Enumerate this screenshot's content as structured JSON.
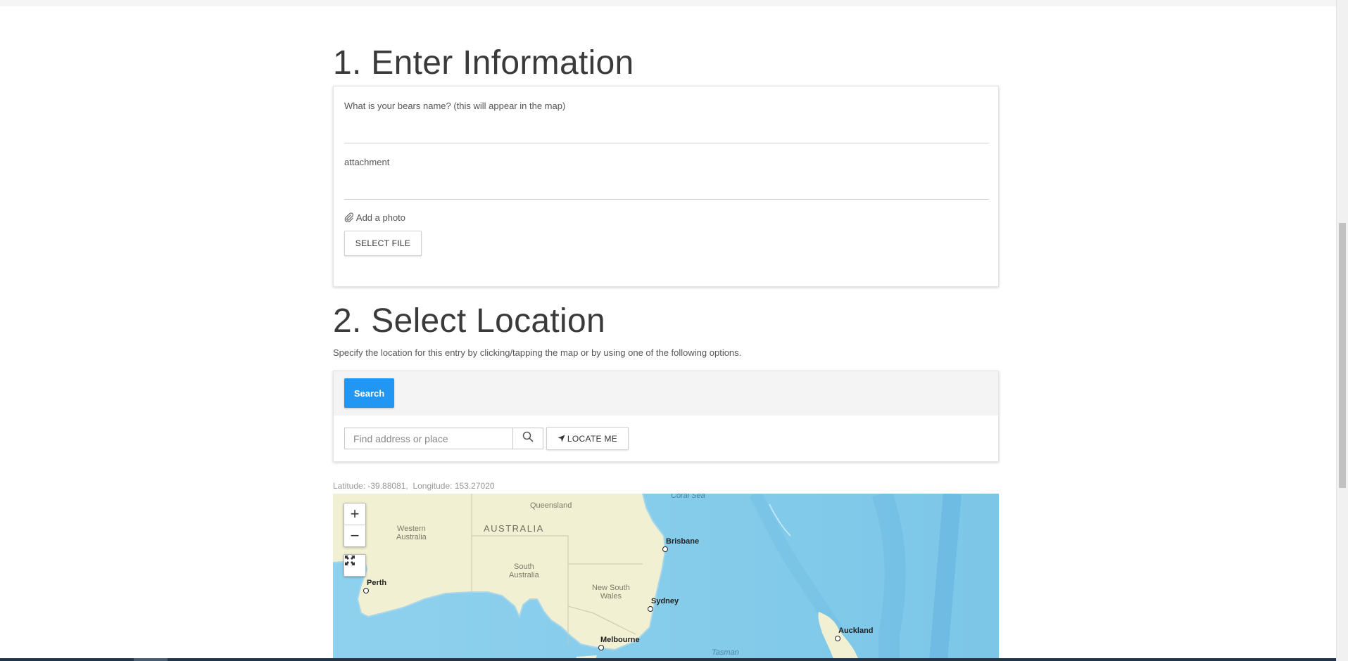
{
  "section1": {
    "title": "1. Enter Information",
    "bear_name_label": "What is your bears name? (this will appear in the map)",
    "attachment_label": "attachment",
    "add_photo_label": "Add a photo",
    "select_file_label": "SELECT FILE"
  },
  "section2": {
    "title": "2. Select Location",
    "description": "Specify the location for this entry by clicking/tapping the map or by using one of the following options.",
    "search_tab_label": "Search",
    "search_placeholder": "Find address or place",
    "locate_me_label": "LOCATE ME",
    "latitude_text": "Latitude: -39.88081,",
    "longitude_text": "Longitude: 153.27020"
  },
  "map": {
    "zoom_in": "+",
    "zoom_out": "−",
    "icons": [
      "search-icon",
      "locate-arrow-icon",
      "paperclip-icon",
      "fullscreen-icon"
    ],
    "country_label": "AUSTRALIA",
    "regions": {
      "western_australia": "Western\nAustralia",
      "queensland": "Queensland",
      "south_australia": "South\nAustralia",
      "new_south_wales": "New South\nWales"
    },
    "seas": {
      "coral_sea": "Coral Sea",
      "tasman": "Tasman"
    },
    "cities": {
      "perth": "Perth",
      "brisbane": "Brisbane",
      "sydney": "Sydney",
      "melbourne": "Melbourne",
      "auckland": "Auckland"
    },
    "colors": {
      "land": "#f2f0d2",
      "ocean": "#86cbe9",
      "deep_ocean": "#6fbde4"
    }
  },
  "colors": {
    "primary": "#2196f3",
    "title_text": "#3a3a3a"
  }
}
